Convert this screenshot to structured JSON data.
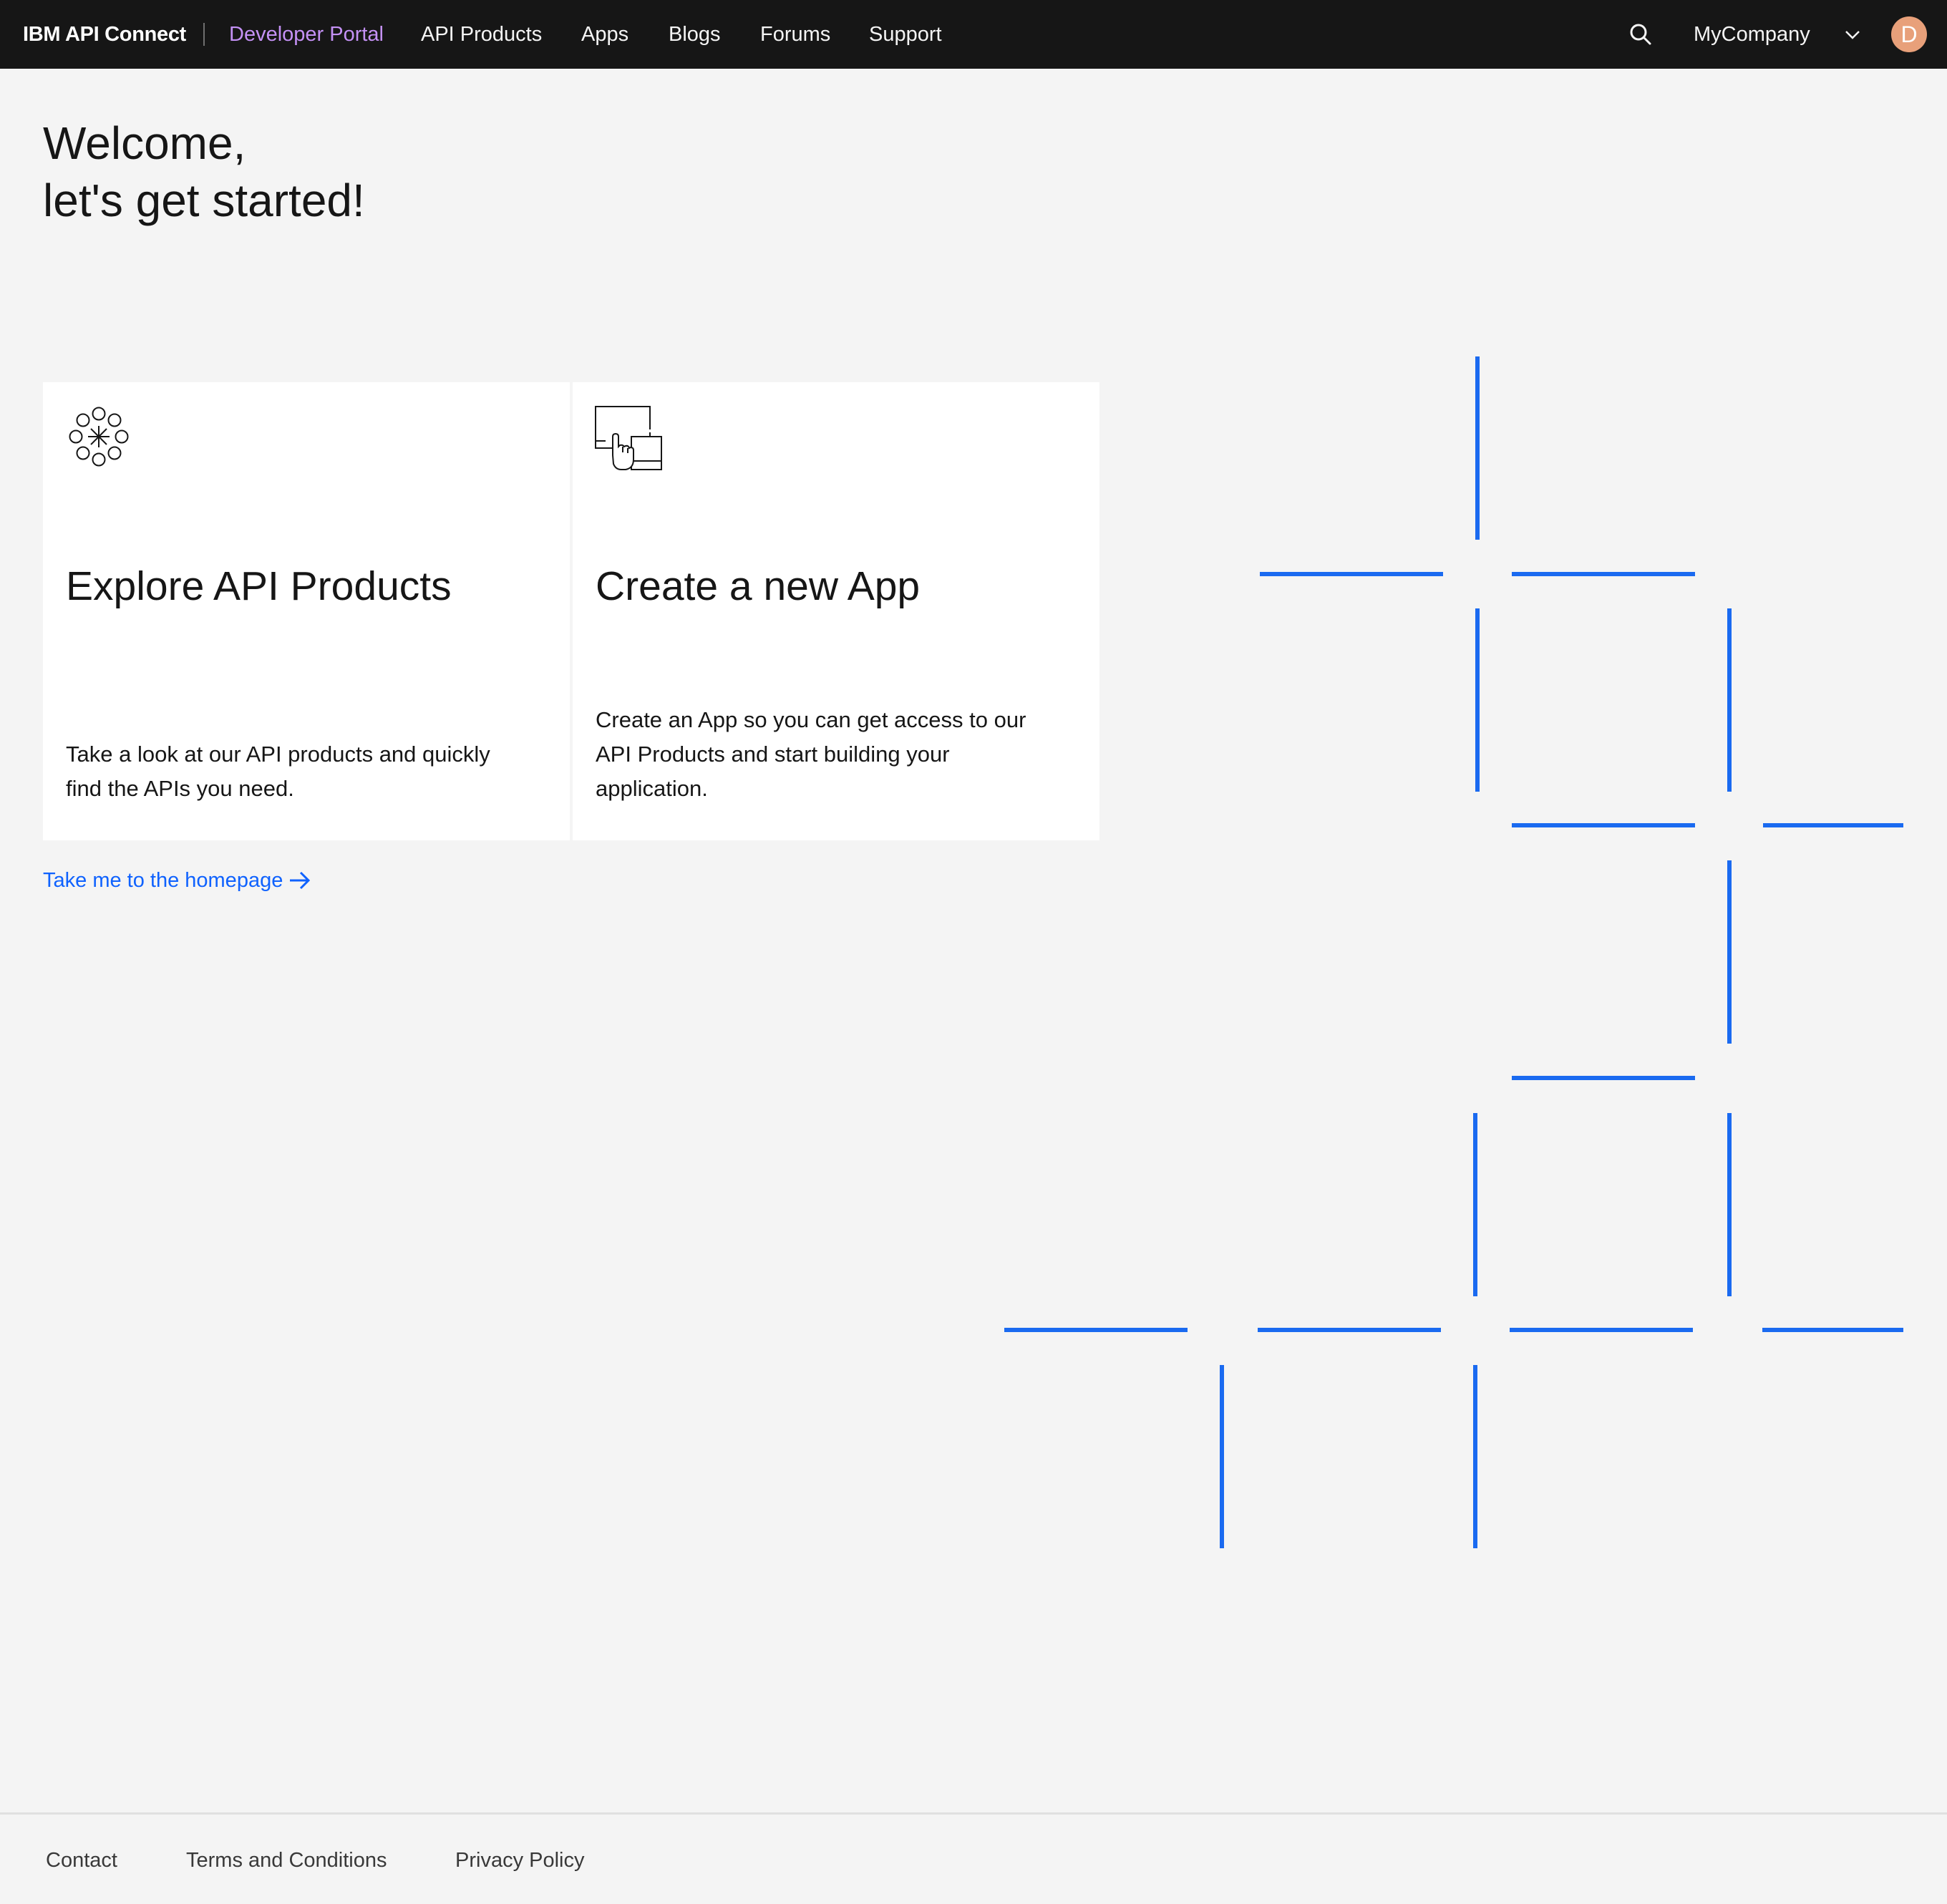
{
  "header": {
    "brand": "IBM API Connect",
    "portal": "Developer Portal",
    "nav": [
      "API Products",
      "Apps",
      "Blogs",
      "Forums",
      "Support"
    ],
    "org": "MyCompany",
    "avatar_letter": "D",
    "search_icon": "search-icon"
  },
  "welcome": {
    "line1": "Welcome,",
    "line2": "let's get started!"
  },
  "tiles": [
    {
      "icon": "api-network-icon",
      "title": "Explore API Products",
      "description": "Take a look at our API products and quickly find the APIs you need."
    },
    {
      "icon": "app-devices-icon",
      "title": "Create a new App",
      "description": "Create an App so you can get access to our API Products and start building your application."
    }
  ],
  "homepage_link": "Take me to the homepage",
  "footer": {
    "links": [
      "Contact",
      "Terms and Conditions",
      "Privacy Policy"
    ]
  },
  "colors": {
    "header_bg": "#161616",
    "portal_accent": "#c491f5",
    "link_blue": "#0f62fe",
    "page_bg": "#f4f4f4"
  }
}
